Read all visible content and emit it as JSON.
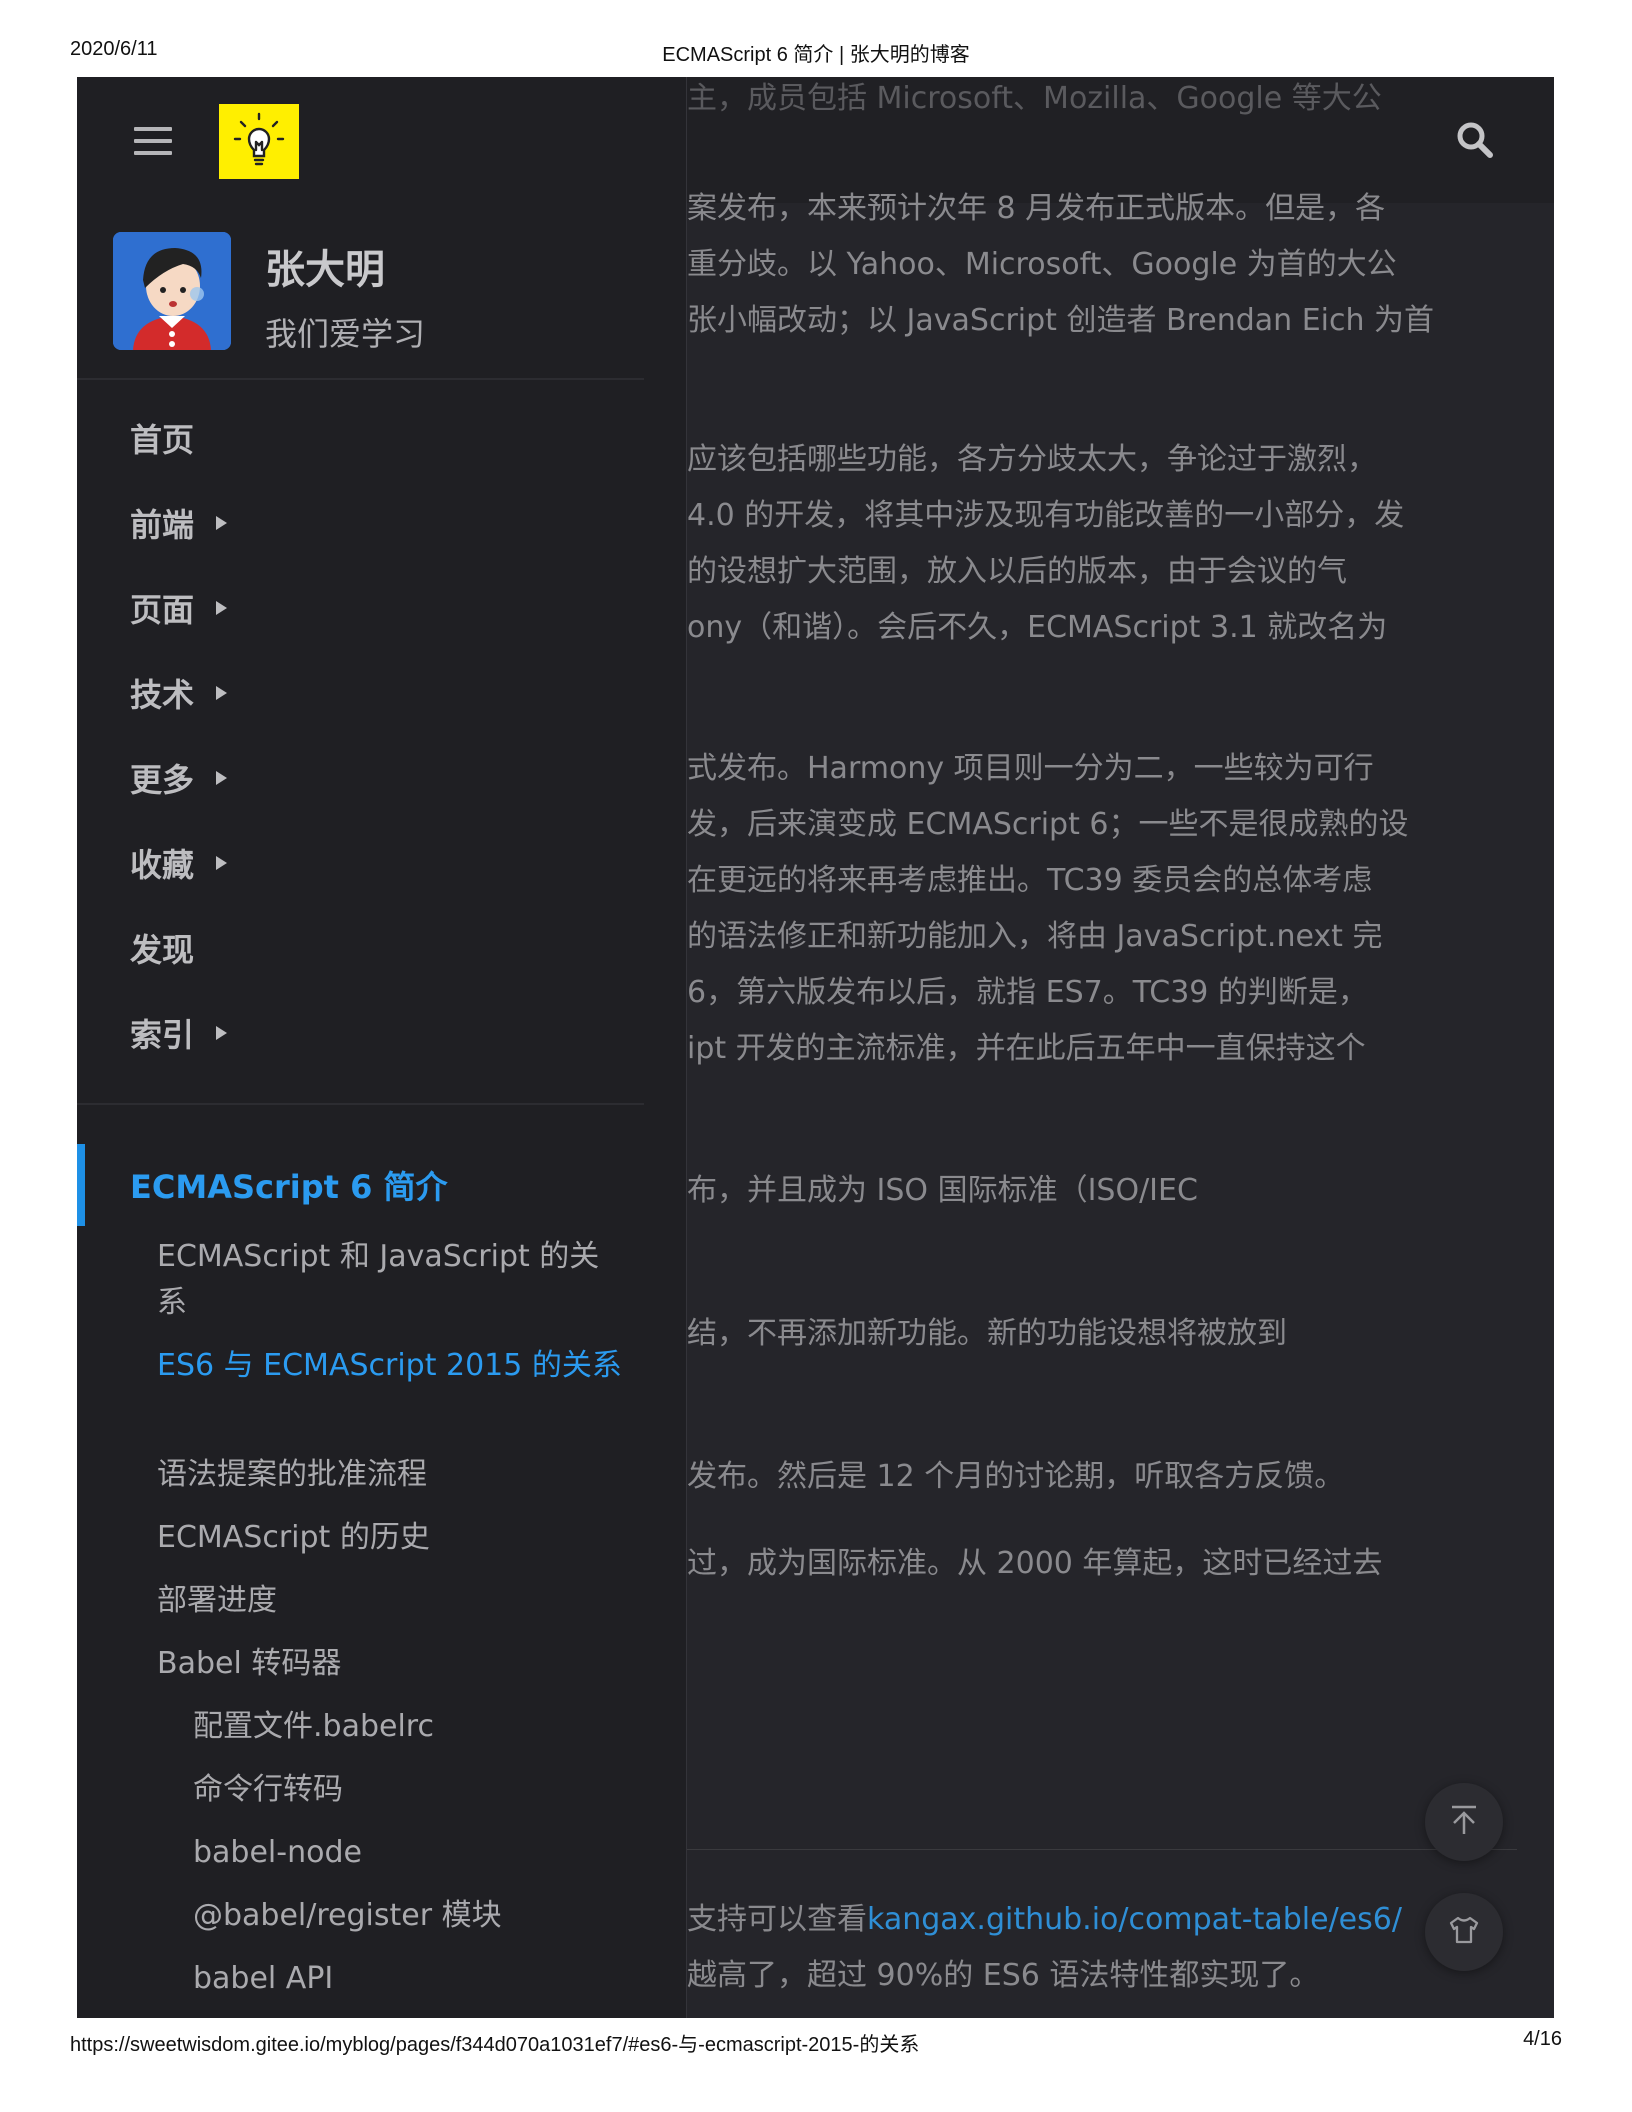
{
  "print_header": {
    "date": "2020/6/11",
    "title": "ECMAScript 6 简介 | 张大明的博客"
  },
  "print_footer": {
    "url": "https://sweetwisdom.gitee.io/myblog/pages/f344d070a1031ef7/#es6-与-ecmascript-2015-的关系",
    "page": "4/16"
  },
  "sidebar": {
    "user_name": "张大明",
    "user_tagline": "我们爱学习",
    "nav": [
      {
        "label": "首页",
        "has_submenu": false
      },
      {
        "label": "前端",
        "has_submenu": true
      },
      {
        "label": "页面",
        "has_submenu": true
      },
      {
        "label": "技术",
        "has_submenu": true
      },
      {
        "label": "更多",
        "has_submenu": true
      },
      {
        "label": "收藏",
        "has_submenu": true
      },
      {
        "label": "发现",
        "has_submenu": false
      },
      {
        "label": "索引",
        "has_submenu": true
      }
    ],
    "toc_title": "ECMAScript 6 简介",
    "toc": [
      {
        "label": "ECMAScript 和 JavaScript 的关系"
      },
      {
        "label": "ES6 与 ECMAScript 2015 的关系",
        "active": true
      },
      {
        "label": "语法提案的批准流程"
      },
      {
        "label": "ECMAScript 的历史"
      },
      {
        "label": "部署进度"
      },
      {
        "label": "Babel 转码器"
      },
      {
        "label": "配置文件.babelrc"
      },
      {
        "label": "命令行转码"
      },
      {
        "label": "babel-node"
      },
      {
        "label": "@babel/register 模块"
      },
      {
        "label": "babel API"
      }
    ]
  },
  "article": {
    "lines": [
      "主，成员包括 Microsoft、Mozilla、Google 等大公",
      "案发布，本来预计次年 8 月发布正式版本。但是，各",
      "重分歧。以 Yahoo、Microsoft、Google 为首的大公",
      "张小幅改动；以 JavaScript 创造者 Brendan Eich 为首",
      "应该包括哪些功能，各方分歧太大，争论过于激烈，",
      "4.0 的开发，将其中涉及现有功能改善的一小部分，发",
      "的设想扩大范围，放入以后的版本，由于会议的气",
      "ony（和谐）。会后不久，ECMAScript 3.1 就改名为",
      "式发布。Harmony 项目则一分为二，一些较为可行",
      "发，后来演变成 ECMAScript 6；一些不是很成熟的设",
      "在更远的将来再考虑推出。TC39 委员会的总体考虑",
      "的语法修正和新功能加入，将由 JavaScript.next 完",
      "6，第六版发布以后，就指 ES7。TC39 的判断是，",
      "ipt 开发的主流标准，并在此后五年中一直保持这个",
      "布，并且成为 ISO 国际标准（ISO/IEC",
      "结，不再添加新功能。新的功能设想将被放到",
      "发布。然后是 12 个月的讨论期，听取各方反馈。",
      "过，成为国际标准。从 2000 年算起，这时已经过去"
    ],
    "compat_prefix": "支持可以查看",
    "compat_link": "kangax.github.io/compat-table/es6/",
    "compat_line2": "越高了，超过 90%的 ES6 语法特性都实现了。"
  },
  "icons": {
    "search": "search-icon",
    "back_to_top": "arrow-up-icon",
    "theme": "shirt-icon"
  },
  "colors": {
    "accent": "#2b9bf0",
    "sidebar_bg": "#1f1f23",
    "logo_bg": "#ffef00"
  }
}
